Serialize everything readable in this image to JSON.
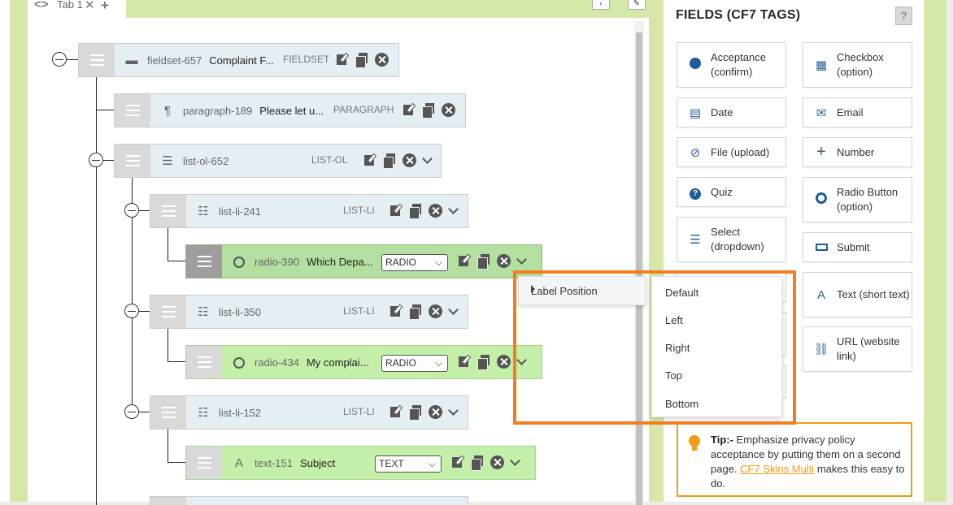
{
  "tab": {
    "label": "Tab 1"
  },
  "tree": {
    "rows": [
      {
        "id": "fieldset-657",
        "label": "Complaint F...",
        "type": "FIELDSET",
        "icon": "folder-icon"
      },
      {
        "id": "paragraph-189",
        "label": "Please let u...",
        "type": "PARAGRAPH",
        "icon": "pilcrow-icon"
      },
      {
        "id": "list-ol-652",
        "label": "",
        "type": "LIST-OL",
        "icon": "ordered-list-icon"
      },
      {
        "id": "list-li-241",
        "label": "",
        "type": "LIST-LI",
        "icon": "list-icon"
      },
      {
        "id": "radio-390",
        "label": "Which Depa...",
        "type": "RADIO",
        "icon": "radio-icon"
      },
      {
        "id": "list-li-350",
        "label": "",
        "type": "LIST-LI",
        "icon": "list-icon"
      },
      {
        "id": "radio-434",
        "label": "My complai...",
        "type": "RADIO",
        "icon": "radio-icon"
      },
      {
        "id": "list-li-152",
        "label": "",
        "type": "LIST-LI",
        "icon": "list-icon"
      },
      {
        "id": "text-151",
        "label": "Subject",
        "type": "TEXT",
        "icon": "text-icon"
      }
    ]
  },
  "panel": {
    "title": "FIELDS (CF7 TAGS)",
    "help": "?",
    "fields": [
      {
        "label": "Acceptance (confirm)",
        "icon": "check-circle-icon"
      },
      {
        "label": "Checkbox (option)",
        "icon": "checkbox-grid-icon"
      },
      {
        "label": "Date",
        "icon": "calendar-icon"
      },
      {
        "label": "Email",
        "icon": "envelope-icon"
      },
      {
        "label": "File (upload)",
        "icon": "paperclip-icon"
      },
      {
        "label": "Number",
        "icon": "plus-icon"
      },
      {
        "label": "Quiz",
        "icon": "question-circle-icon"
      },
      {
        "label": "Radio Button (option)",
        "icon": "radio-ring-icon"
      },
      {
        "label": "Select (dropdown)",
        "icon": "select-list-icon"
      },
      {
        "label": "Submit",
        "icon": "submit-rect-icon"
      },
      {
        "label": "Text (short text)",
        "icon": "text-a-icon"
      },
      {
        "label": "URL (website link)",
        "icon": "link-icon"
      }
    ],
    "tip": {
      "title": "Tip:-",
      "text_before": "Emphasize privacy policy acceptance by putting them on a second page.",
      "link": "CF7 Skins Multi",
      "text_after": "makes this easy to do."
    }
  },
  "context_menu": {
    "main_item": "Label Position",
    "sub_items": [
      "Default",
      "Left",
      "Right",
      "Top",
      "Bottom"
    ]
  },
  "colors": {
    "accent_green": "#d6e8a8",
    "highlight_orange": "#f37e22",
    "tip_orange": "#f39c12",
    "icon_blue": "#1e5c9a"
  }
}
